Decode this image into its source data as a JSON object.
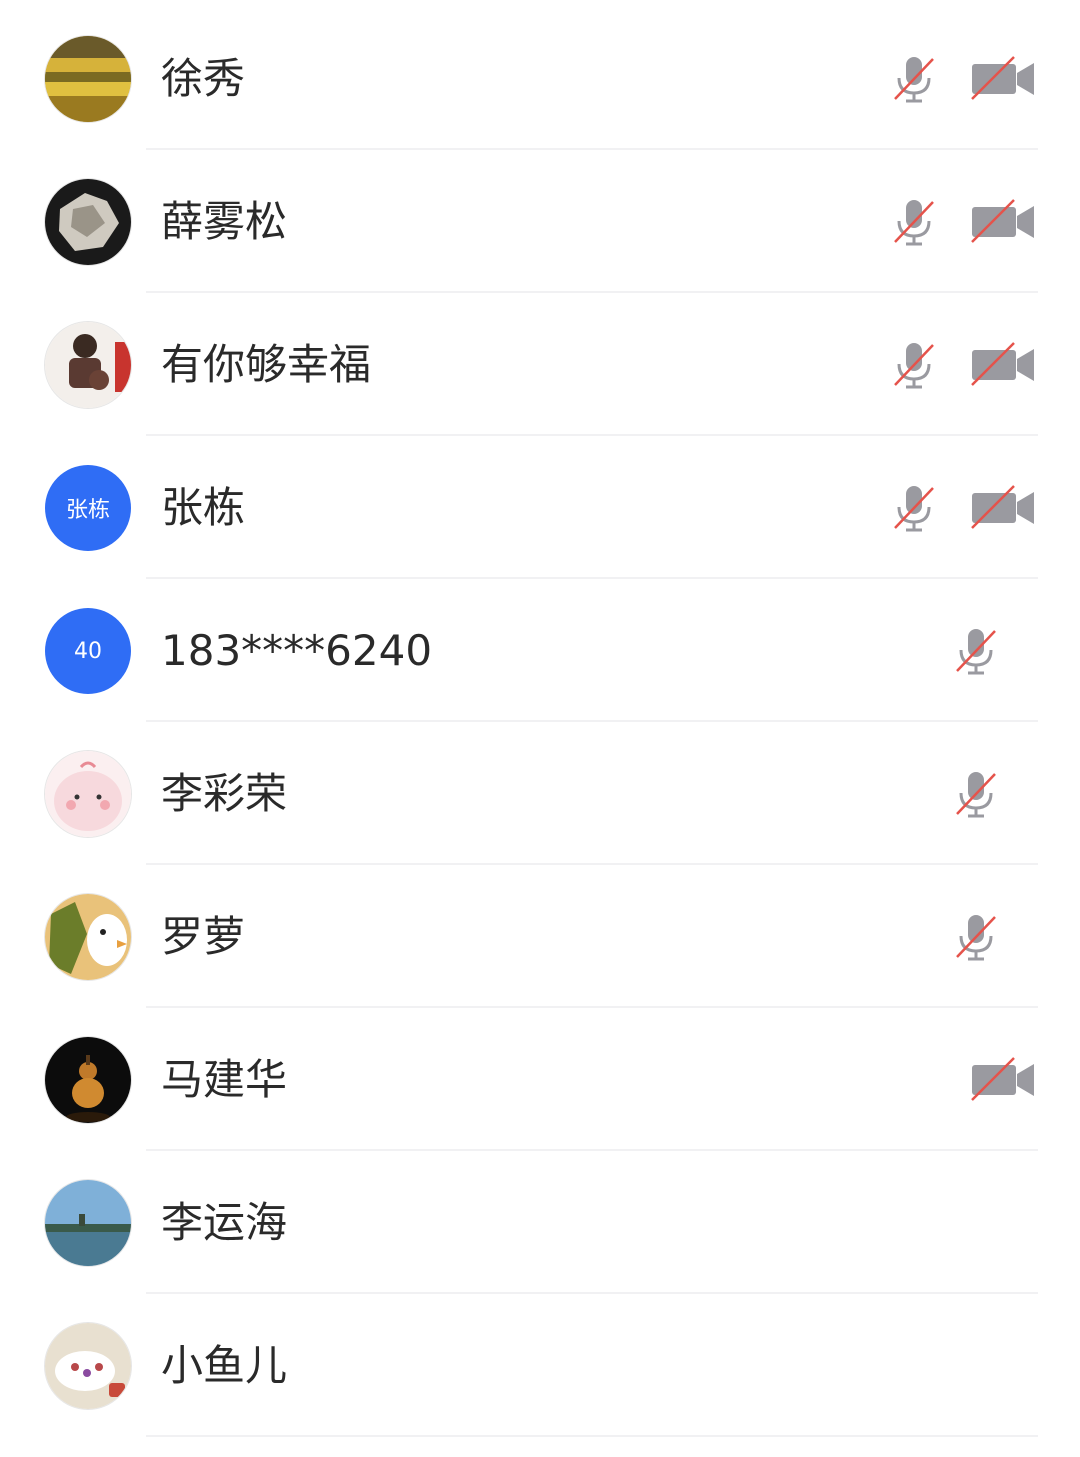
{
  "participants": [
    {
      "name": "徐秀",
      "avatar": "photo",
      "mic_muted": true,
      "cam_off": true
    },
    {
      "name": "薛雾松",
      "avatar": "photo",
      "mic_muted": true,
      "cam_off": true
    },
    {
      "name": "有你够幸福",
      "avatar": "photo",
      "mic_muted": true,
      "cam_off": true
    },
    {
      "name": "张栋",
      "avatar_text": "张栋",
      "mic_muted": true,
      "cam_off": true
    },
    {
      "name": "183****6240",
      "avatar_text": "40",
      "mic_muted": true,
      "cam_off": false
    },
    {
      "name": "李彩荣",
      "avatar": "photo",
      "mic_muted": true,
      "cam_off": false
    },
    {
      "name": "罗萝",
      "avatar": "photo",
      "mic_muted": true,
      "cam_off": false
    },
    {
      "name": "马建华",
      "avatar": "photo",
      "mic_muted": false,
      "cam_off": true
    },
    {
      "name": "李运海",
      "avatar": "photo",
      "mic_muted": false,
      "cam_off": false
    },
    {
      "name": "小鱼儿",
      "avatar": "photo",
      "mic_muted": false,
      "cam_off": false
    }
  ],
  "colors": {
    "avatar_blue": "#2f6df5",
    "icon_gray": "#9a9aa0",
    "slash_red": "#e5534b"
  }
}
